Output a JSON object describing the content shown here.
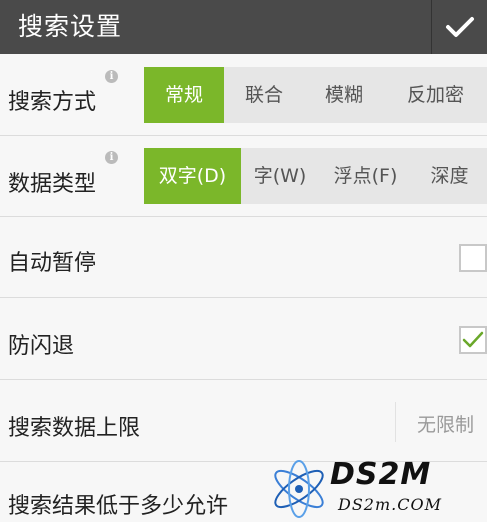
{
  "header": {
    "title": "搜索设置"
  },
  "search_mode": {
    "label": "搜索方式",
    "options": [
      "常规",
      "联合",
      "模糊",
      "反加密"
    ],
    "selected": "常规"
  },
  "data_type": {
    "label": "数据类型",
    "options": [
      "双字(D)",
      "字(W)",
      "浮点(F)",
      "深度"
    ],
    "selected": "双字(D)"
  },
  "auto_pause": {
    "label": "自动暂停",
    "checked": false
  },
  "anti_flash": {
    "label": "防闪退",
    "checked": true
  },
  "search_limit": {
    "label": "搜索数据上限",
    "value": "无限制"
  },
  "search_result": {
    "label": "搜索结果低于多少允许"
  },
  "watermark": {
    "brand": "DS2M",
    "site": "DS2m.COM"
  },
  "colors": {
    "accent": "#7bb72a",
    "header": "#4a4a4a"
  }
}
